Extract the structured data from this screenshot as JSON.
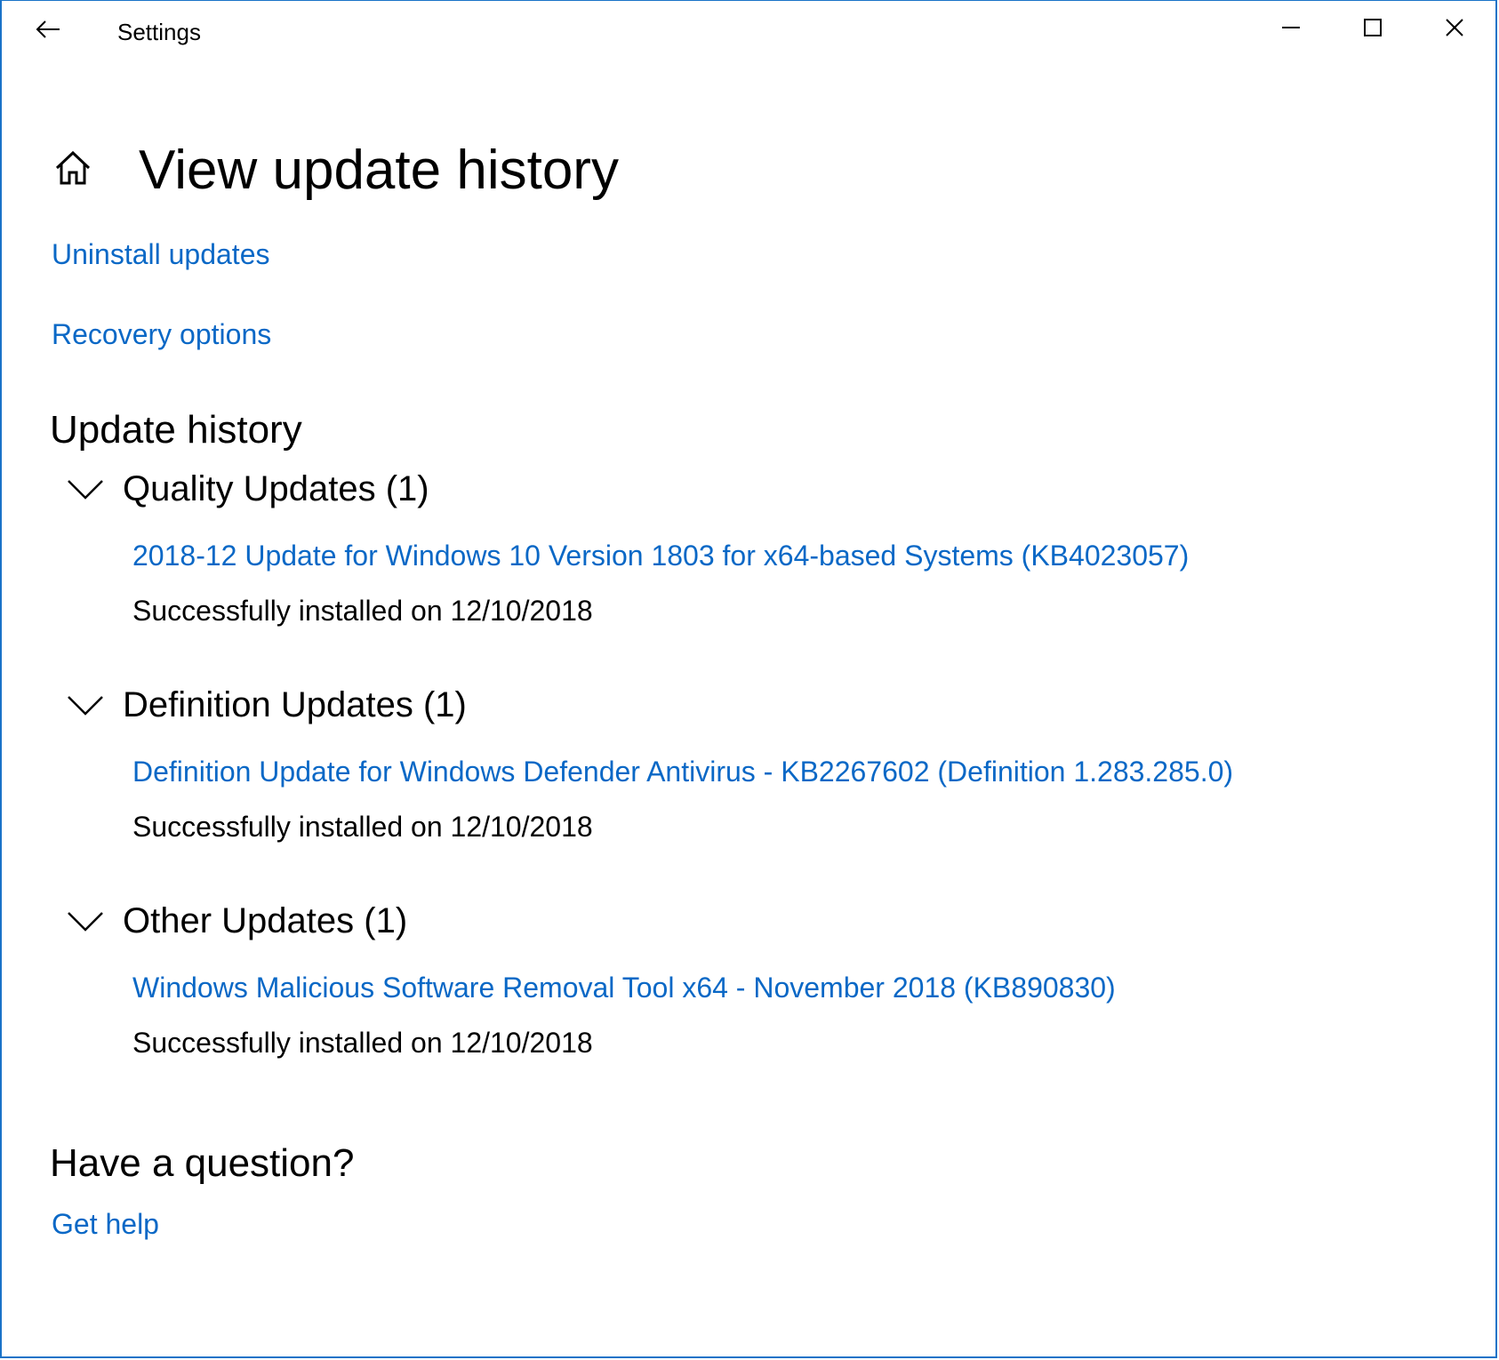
{
  "window": {
    "title": "Settings",
    "back_icon": "back-arrow-icon",
    "controls": {
      "minimize_icon": "minimize-icon",
      "maximize_icon": "maximize-icon",
      "close_icon": "close-icon"
    }
  },
  "header": {
    "home_icon": "home-icon",
    "title": "View update history"
  },
  "links": {
    "uninstall": "Uninstall updates",
    "recovery": "Recovery options"
  },
  "history": {
    "title": "Update history",
    "groups": [
      {
        "label": "Quality Updates (1)",
        "items": [
          {
            "name": "2018-12 Update for Windows 10 Version 1803 for x64-based Systems (KB4023057)",
            "status": "Successfully installed on 12/10/2018"
          }
        ]
      },
      {
        "label": "Definition Updates (1)",
        "items": [
          {
            "name": "Definition Update for Windows Defender Antivirus - KB2267602 (Definition 1.283.285.0)",
            "status": "Successfully installed on 12/10/2018"
          }
        ]
      },
      {
        "label": "Other Updates (1)",
        "items": [
          {
            "name": "Windows Malicious Software Removal Tool x64 - November 2018 (KB890830)",
            "status": "Successfully installed on 12/10/2018"
          }
        ]
      }
    ]
  },
  "help": {
    "title": "Have a question?",
    "link": "Get help"
  },
  "colors": {
    "link": "#0a68c6",
    "border": "#1a73c8",
    "text": "#000000",
    "background": "#ffffff"
  }
}
